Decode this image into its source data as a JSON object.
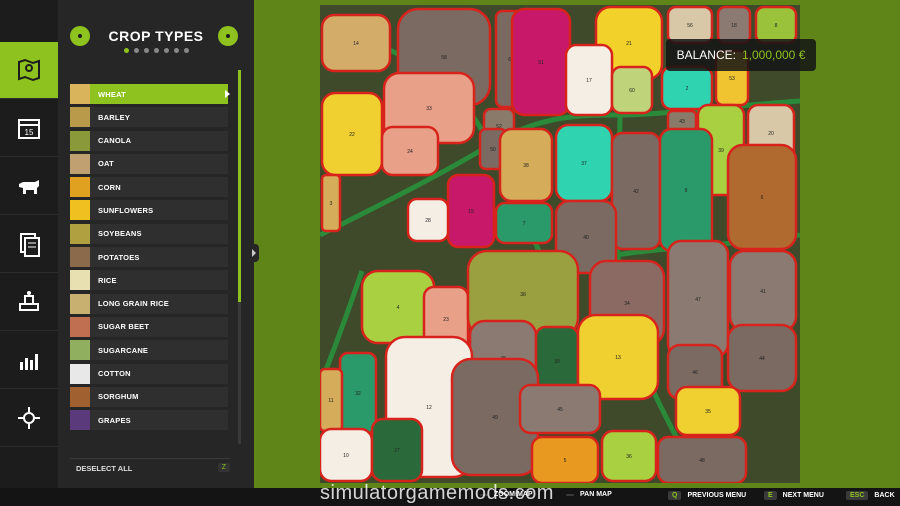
{
  "panel": {
    "title": "CROP TYPES",
    "page_count": 7,
    "page_index": 0
  },
  "crops": [
    {
      "label": "WHEAT",
      "color": "#d9b45a",
      "selected": true
    },
    {
      "label": "BARLEY",
      "color": "#b89a4a"
    },
    {
      "label": "CANOLA",
      "color": "#8a9a3a"
    },
    {
      "label": "OAT",
      "color": "#c0a070"
    },
    {
      "label": "CORN",
      "color": "#e0a020"
    },
    {
      "label": "SUNFLOWERS",
      "color": "#f0c020"
    },
    {
      "label": "SOYBEANS",
      "color": "#b0a040"
    },
    {
      "label": "POTATOES",
      "color": "#8a6a4a"
    },
    {
      "label": "RICE",
      "color": "#e8e0b0"
    },
    {
      "label": "LONG GRAIN RICE",
      "color": "#c8b070"
    },
    {
      "label": "SUGAR BEET",
      "color": "#c07050"
    },
    {
      "label": "SUGARCANE",
      "color": "#90b060"
    },
    {
      "label": "COTTON",
      "color": "#e8e8e8"
    },
    {
      "label": "SORGHUM",
      "color": "#a06030"
    },
    {
      "label": "GRAPES",
      "color": "#5a3a7a"
    }
  ],
  "deselect": {
    "label": "DESELECT ALL",
    "key": "Z"
  },
  "balance": {
    "label": "BALANCE:",
    "amount": "1,000,000 €"
  },
  "footer": [
    {
      "key": "",
      "label": "ZOOM MAP"
    },
    {
      "key": "",
      "label": "PAN MAP"
    },
    {
      "key": "Q",
      "label": "PREVIOUS MENU"
    },
    {
      "key": "E",
      "label": "NEXT MENU"
    },
    {
      "key": "ESC",
      "label": "BACK"
    }
  ],
  "watermark": "simulatorgamemods.com",
  "colors": {
    "accent": "#8dc21f",
    "road": "#2a8a3a",
    "border_red": "#d8231c"
  },
  "map_fields": [
    {
      "id": "14",
      "color": "#d4ac6a"
    },
    {
      "id": "58",
      "color": "#7a6a62"
    },
    {
      "id": "62",
      "color": "#7a6a62"
    },
    {
      "id": "51",
      "color": "#c8186a"
    },
    {
      "id": "21",
      "color": "#f2d12a"
    },
    {
      "id": "56",
      "color": "#d8c8a8"
    },
    {
      "id": "18",
      "color": "#8a7a72"
    },
    {
      "id": "8",
      "color": "#9ac23a"
    },
    {
      "id": "17",
      "color": "#f4eee4"
    },
    {
      "id": "60",
      "color": "#bfd47a"
    },
    {
      "id": "2",
      "color": "#2fd3b0"
    },
    {
      "id": "53",
      "color": "#f0c430"
    },
    {
      "id": "43",
      "color": "#8a7a6a"
    },
    {
      "id": "52",
      "color": "#8a7a6a"
    },
    {
      "id": "22",
      "color": "#f0d030"
    },
    {
      "id": "33",
      "color": "#e8a088"
    },
    {
      "id": "24",
      "color": "#e8a088"
    },
    {
      "id": "50",
      "color": "#7a6a62"
    },
    {
      "id": "39",
      "color": "#a8d040"
    },
    {
      "id": "20",
      "color": "#d8c8a8"
    },
    {
      "id": "38",
      "color": "#d4ac5a"
    },
    {
      "id": "37",
      "color": "#2fd3b0"
    },
    {
      "id": "42",
      "color": "#7a6a62"
    },
    {
      "id": "9",
      "color": "#2a9a6a"
    },
    {
      "id": "6",
      "color": "#b06a30"
    },
    {
      "id": "15",
      "color": "#c8186a"
    },
    {
      "id": "28",
      "color": "#f4eee4"
    },
    {
      "id": "7",
      "color": "#2a9a6a"
    },
    {
      "id": "40",
      "color": "#7a6a62"
    },
    {
      "id": "3",
      "color": "#d4ac5a"
    },
    {
      "id": "34",
      "color": "#8a6a62"
    },
    {
      "id": "47",
      "color": "#8a7a72"
    },
    {
      "id": "41",
      "color": "#8a7a72"
    },
    {
      "id": "4",
      "color": "#a8d040"
    },
    {
      "id": "23",
      "color": "#e8a088"
    },
    {
      "id": "38b",
      "color": "#9aa040"
    },
    {
      "id": "48",
      "color": "#8a7a72"
    },
    {
      "id": "30",
      "color": "#2a6a3a"
    },
    {
      "id": "13",
      "color": "#f0d030"
    },
    {
      "id": "46",
      "color": "#7a6a62"
    },
    {
      "id": "44",
      "color": "#7a6a62"
    },
    {
      "id": "32",
      "color": "#2a9a6a"
    },
    {
      "id": "12",
      "color": "#f4eee4"
    },
    {
      "id": "49",
      "color": "#7a6a62"
    },
    {
      "id": "45",
      "color": "#8a7a72"
    },
    {
      "id": "35",
      "color": "#f0d030"
    },
    {
      "id": "11",
      "color": "#d4ac5a"
    },
    {
      "id": "10",
      "color": "#f4eee4"
    },
    {
      "id": "27",
      "color": "#2a6a3a"
    },
    {
      "id": "5",
      "color": "#e89a20"
    },
    {
      "id": "36",
      "color": "#a8d040"
    },
    {
      "id": "48b",
      "color": "#7a6a62"
    }
  ]
}
